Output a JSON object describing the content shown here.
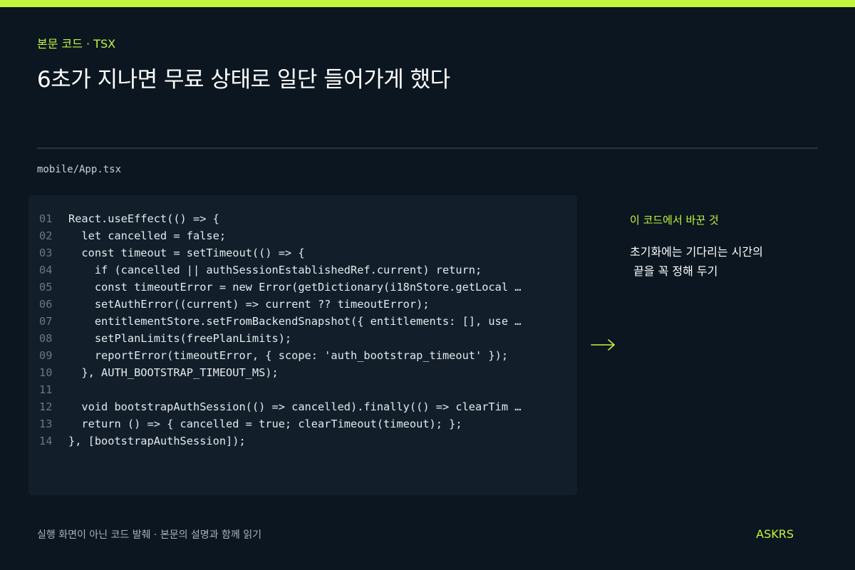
{
  "header": {
    "eyebrow": "본문 코드 · TSX",
    "title": "6초가 지나면 무료 상태로 일단 들어가게 했다"
  },
  "file": {
    "path": "mobile/App.tsx"
  },
  "code": {
    "lines": [
      {
        "no": "01",
        "text": "React.useEffect(() => {"
      },
      {
        "no": "02",
        "text": "  let cancelled = false;"
      },
      {
        "no": "03",
        "text": "  const timeout = setTimeout(() => {"
      },
      {
        "no": "04",
        "text": "    if (cancelled || authSessionEstablishedRef.current) return;"
      },
      {
        "no": "05",
        "text": "    const timeoutError = new Error(getDictionary(i18nStore.getLocal …"
      },
      {
        "no": "06",
        "text": "    setAuthError((current) => current ?? timeoutError);"
      },
      {
        "no": "07",
        "text": "    entitlementStore.setFromBackendSnapshot({ entitlements: [], use …"
      },
      {
        "no": "08",
        "text": "    setPlanLimits(freePlanLimits);"
      },
      {
        "no": "09",
        "text": "    reportError(timeoutError, { scope: 'auth_bootstrap_timeout' });"
      },
      {
        "no": "10",
        "text": "  }, AUTH_BOOTSTRAP_TIMEOUT_MS);"
      },
      {
        "no": "11",
        "text": ""
      },
      {
        "no": "12",
        "text": "  void bootstrapAuthSession(() => cancelled).finally(() => clearTim …"
      },
      {
        "no": "13",
        "text": "  return () => { cancelled = true; clearTimeout(timeout); };"
      },
      {
        "no": "14",
        "text": "}, [bootstrapAuthSession]);"
      }
    ]
  },
  "note": {
    "heading": "이 코드에서 바꾼 것",
    "body": "초기화에는 기다리는 시간의\n 끝을 꼭 정해 두기"
  },
  "footer": {
    "caption": "실행 화면이 아닌 코드 발췌 · 본문의 설명과 함께 읽기",
    "brand": "ASKRS"
  },
  "colors": {
    "accent": "#c3f53d",
    "background": "#0b1620",
    "panel": "#121f2b"
  },
  "icons": {
    "arrow": "arrow-right-icon"
  }
}
